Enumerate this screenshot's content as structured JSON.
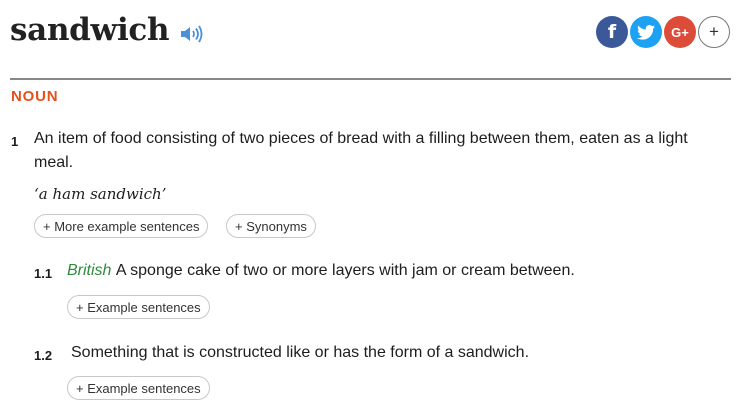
{
  "entry": {
    "headword": "sandwich",
    "audio_icon": "speaker-icon",
    "social": [
      {
        "name": "facebook-icon",
        "glyph": "f",
        "color": "#3b5998"
      },
      {
        "name": "twitter-icon",
        "glyph": "",
        "color": "#1da1f2"
      },
      {
        "name": "google-plus-icon",
        "glyph": "G+",
        "color": "#dd4b39"
      },
      {
        "name": "more-share-icon",
        "glyph": "+",
        "color": "#ffffff"
      }
    ],
    "part_of_speech": "NOUN"
  },
  "senses": [
    {
      "number": "1",
      "definition": "An item of food consisting of two pieces of bread with a filling between them, eaten as a light meal.",
      "definition_line1": "An item of food consisting of two pieces of bread with a filling between them, eaten as a light",
      "definition_line2": "meal.",
      "example": "‘a ham sandwich’",
      "buttons": [
        "+ More example sentences",
        "+ Synonyms"
      ]
    },
    {
      "number": "1.1",
      "register": "British",
      "definition": "A sponge cake of two or more layers with jam or cream between.",
      "buttons": [
        "+ Example sentences"
      ]
    },
    {
      "number": "1.2",
      "definition": "Something that is constructed like or has the form of a sandwich.",
      "buttons": [
        "+ Example sentences"
      ]
    }
  ]
}
